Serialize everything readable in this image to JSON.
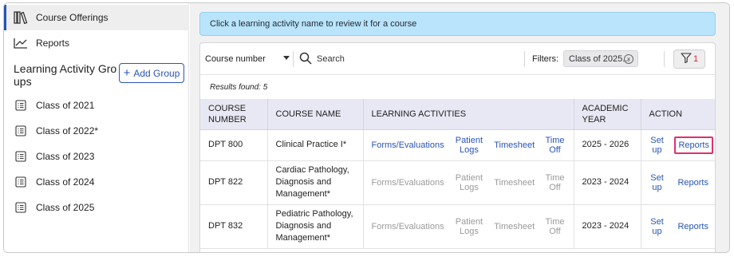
{
  "sidebar": {
    "nav": [
      {
        "label": "Course Offerings",
        "icon": "books-icon",
        "active": true
      },
      {
        "label": "Reports",
        "icon": "line-chart-icon",
        "active": false
      }
    ],
    "group_title": "Learning Activity Groups",
    "add_group_label": "Add Group",
    "groups": [
      {
        "label": "Class of 2021"
      },
      {
        "label": "Class of 2022*"
      },
      {
        "label": "Class of 2023"
      },
      {
        "label": "Class of 2024"
      },
      {
        "label": "Class of 2025"
      }
    ]
  },
  "banner": {
    "text": "Click a learning activity name to review it for a course"
  },
  "toolbar": {
    "course_select": "Course number",
    "search_placeholder": "Search",
    "filters_label": "Filters:",
    "filter_chip": "Class of 2025...",
    "filter_count": "1"
  },
  "results": {
    "text": "Results found: 5"
  },
  "table": {
    "headers": {
      "course_number": "COURSE NUMBER",
      "course_name": "COURSE NAME",
      "learning_activities": "LEARNING ACTIVITIES",
      "academic_year": "ACADEMIC YEAR",
      "action": "ACTION"
    },
    "activity_labels": {
      "forms": "Forms/Evaluations",
      "patient_logs": "Patient Logs",
      "timesheet": "Timesheet",
      "time_off": "Time Off"
    },
    "action_labels": {
      "setup": "Set up",
      "reports": "Reports"
    },
    "rows": [
      {
        "course_number": "DPT 800",
        "course_name": "Clinical Practice I*",
        "academic_year": "2025 - 2026",
        "activities_enabled": true
      },
      {
        "course_number": "DPT 822",
        "course_name": "Cardiac Pathology, Diagnosis and Management*",
        "academic_year": "2023 - 2024",
        "activities_enabled": false
      },
      {
        "course_number": "DPT 832",
        "course_name": "Pediatric Pathology, Diagnosis and Management*",
        "academic_year": "2023 - 2024",
        "activities_enabled": false
      }
    ]
  },
  "colors": {
    "accent": "#2855b8",
    "banner": "#b9e4fb",
    "highlight": "#e0306e",
    "filter_count": "#d8262e"
  }
}
